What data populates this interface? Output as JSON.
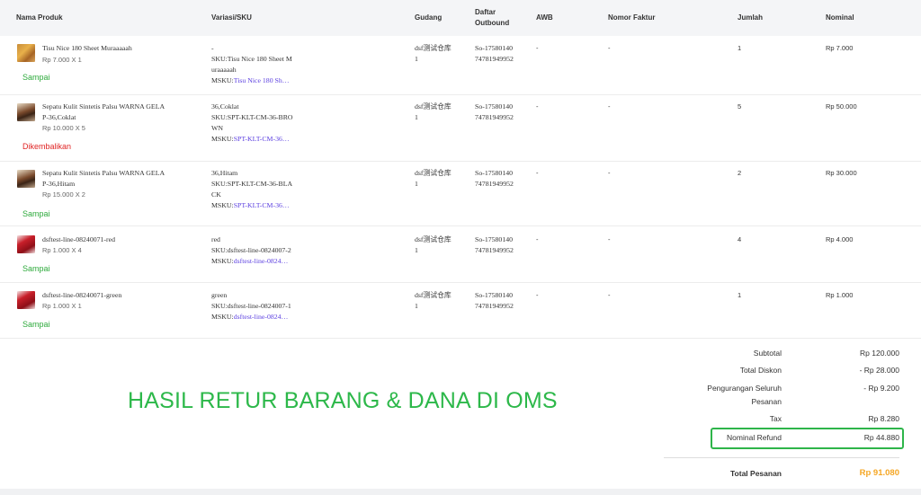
{
  "headers": {
    "product": "Nama Produk",
    "variant": "Variasi/SKU",
    "warehouse": "Gudang",
    "outbound_line1": "Daftar",
    "outbound_line2": "Outbound",
    "awb": "AWB",
    "invoice": "Nomor Faktur",
    "qty": "Jumlah",
    "amount": "Nominal"
  },
  "items": [
    {
      "name_l1": "Tisu Nice 180 Sheet Muraaaaah",
      "name_l2": "",
      "price": "Rp 7.000 X 1",
      "status": "Sampai",
      "variant_l1": "-",
      "sku_l1": "SKU:Tisu Nice 180 Sheet M",
      "sku_l2": "uraaaaah",
      "msku_label": "MSKU:",
      "msku_value": "Tisu Nice 180 Sh…",
      "warehouse_l1": "dsf测试仓库",
      "warehouse_l2": "1",
      "outbound_l1": "So-17580140",
      "outbound_l2": "74781949952",
      "awb": "-",
      "invoice": "-",
      "qty": "1",
      "amount": "Rp 7.000",
      "image": "tissue-box-thumbnail"
    },
    {
      "name_l1": "Sepatu Kulit Sintetis Palsu WARNA GELA",
      "name_l2": "P-36,Coklat",
      "price": "Rp 10.000 X 5",
      "status": "Dikembalikan",
      "variant_l1": "36,Coklat",
      "sku_l1": "SKU:SPT-KLT-CM-36-BRO",
      "sku_l2": "WN",
      "msku_label": "MSKU:",
      "msku_value": "SPT-KLT-CM-36…",
      "warehouse_l1": "dsf测试仓库",
      "warehouse_l2": "1",
      "outbound_l1": "So-17580140",
      "outbound_l2": "74781949952",
      "awb": "-",
      "invoice": "-",
      "qty": "5",
      "amount": "Rp 50.000",
      "image": "shoe-thumbnail"
    },
    {
      "name_l1": "Sepatu Kulit Sintetis Palsu WARNA GELA",
      "name_l2": "P-36,Hitam",
      "price": "Rp 15.000 X 2",
      "status": "Sampai",
      "variant_l1": "36,Hitam",
      "sku_l1": "SKU:SPT-KLT-CM-36-BLA",
      "sku_l2": "CK",
      "msku_label": "MSKU:",
      "msku_value": "SPT-KLT-CM-36…",
      "warehouse_l1": "dsf测试仓库",
      "warehouse_l2": "1",
      "outbound_l1": "So-17580140",
      "outbound_l2": "74781949952",
      "awb": "-",
      "invoice": "-",
      "qty": "2",
      "amount": "Rp 30.000",
      "image": "shoe-thumbnail"
    },
    {
      "name_l1": "dsftest-line-08240071-red",
      "name_l2": "",
      "price": "Rp 1.000 X 4",
      "status": "Sampai",
      "variant_l1": "red",
      "sku_l1": "SKU:dsftest-line-0824007-2",
      "sku_l2": "",
      "msku_label": "MSKU:",
      "msku_value": "dsftest-line-0824…",
      "warehouse_l1": "dsf测试仓库",
      "warehouse_l2": "1",
      "outbound_l1": "So-17580140",
      "outbound_l2": "74781949952",
      "awb": "-",
      "invoice": "-",
      "qty": "4",
      "amount": "Rp 4.000",
      "image": "red-product-thumbnail"
    },
    {
      "name_l1": "dsftest-line-08240071-green",
      "name_l2": "",
      "price": "Rp 1.000 X 1",
      "status": "Sampai",
      "variant_l1": "green",
      "sku_l1": "SKU:dsftest-line-0824007-1",
      "sku_l2": "",
      "msku_label": "MSKU:",
      "msku_value": "dsftest-line-0824…",
      "warehouse_l1": "dsf测试仓库",
      "warehouse_l2": "1",
      "outbound_l1": "So-17580140",
      "outbound_l2": "74781949952",
      "awb": "-",
      "invoice": "-",
      "qty": "1",
      "amount": "Rp 1.000",
      "image": "red-product-thumbnail"
    }
  ],
  "summary": {
    "subtotal_label": "Subtotal",
    "subtotal_value": "Rp 120.000",
    "discount_label": "Total Diskon",
    "discount_value": "- Rp 28.000",
    "reduction_label_l1": "Pengurangan Seluruh",
    "reduction_label_l2": "Pesanan",
    "reduction_value": "- Rp 9.200",
    "tax_label": "Tax",
    "tax_value": "Rp 8.280",
    "refund_label": "Nominal Refund",
    "refund_value": "Rp 44.880",
    "total_label": "Total Pesanan",
    "total_value": "Rp 91.080"
  },
  "overlay_text": "HASIL RETUR BARANG & DANA DI OMS",
  "colors": {
    "status_ok": "#2eaa3c",
    "status_returned": "#e02424",
    "link": "#5b3fe0",
    "highlight_box": "#2eb54a",
    "total_accent": "#f5a623"
  }
}
